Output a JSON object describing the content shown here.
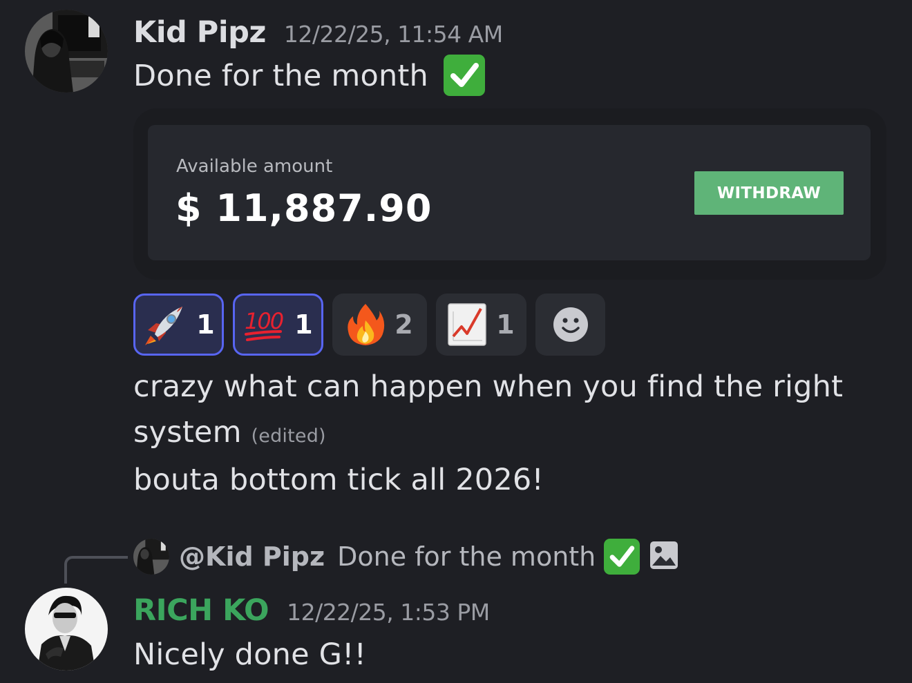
{
  "messages": [
    {
      "username": "Kid Pipz",
      "timestamp": "12/22/25, 11:54 AM",
      "text": "Done for the month",
      "text_emoji": "check-mark-emoji",
      "embed": {
        "label": "Available amount",
        "amount": "$ 11,887.90",
        "button_label": "WITHDRAW"
      },
      "reactions": [
        {
          "emoji": "rocket-emoji",
          "count": "1",
          "active": true
        },
        {
          "emoji": "hundred-points-emoji",
          "count": "1",
          "active": true
        },
        {
          "emoji": "fire-emoji",
          "count": "2",
          "active": false
        },
        {
          "emoji": "chart-increasing-emoji",
          "count": "1",
          "active": false
        }
      ],
      "followups": [
        {
          "line1": "crazy what can happen when you find the right",
          "line2": "system",
          "edited_label": "(edited)"
        },
        {
          "line1": "bouta bottom tick all 2026!"
        }
      ]
    },
    {
      "reply": {
        "mention": "@Kid Pipz",
        "text": "Done for the month",
        "emoji": "check-mark-emoji",
        "attachment_icon": "image-icon"
      },
      "username": "RICH KO",
      "username_color": "#3ba55d",
      "timestamp": "12/22/25, 1:53 PM",
      "text": "Nicely done G!!"
    }
  ],
  "colors": {
    "background": "#1e1f24",
    "accent": "#5865f2",
    "withdraw_button": "#5fb478",
    "username_default": "#dcdde1"
  }
}
